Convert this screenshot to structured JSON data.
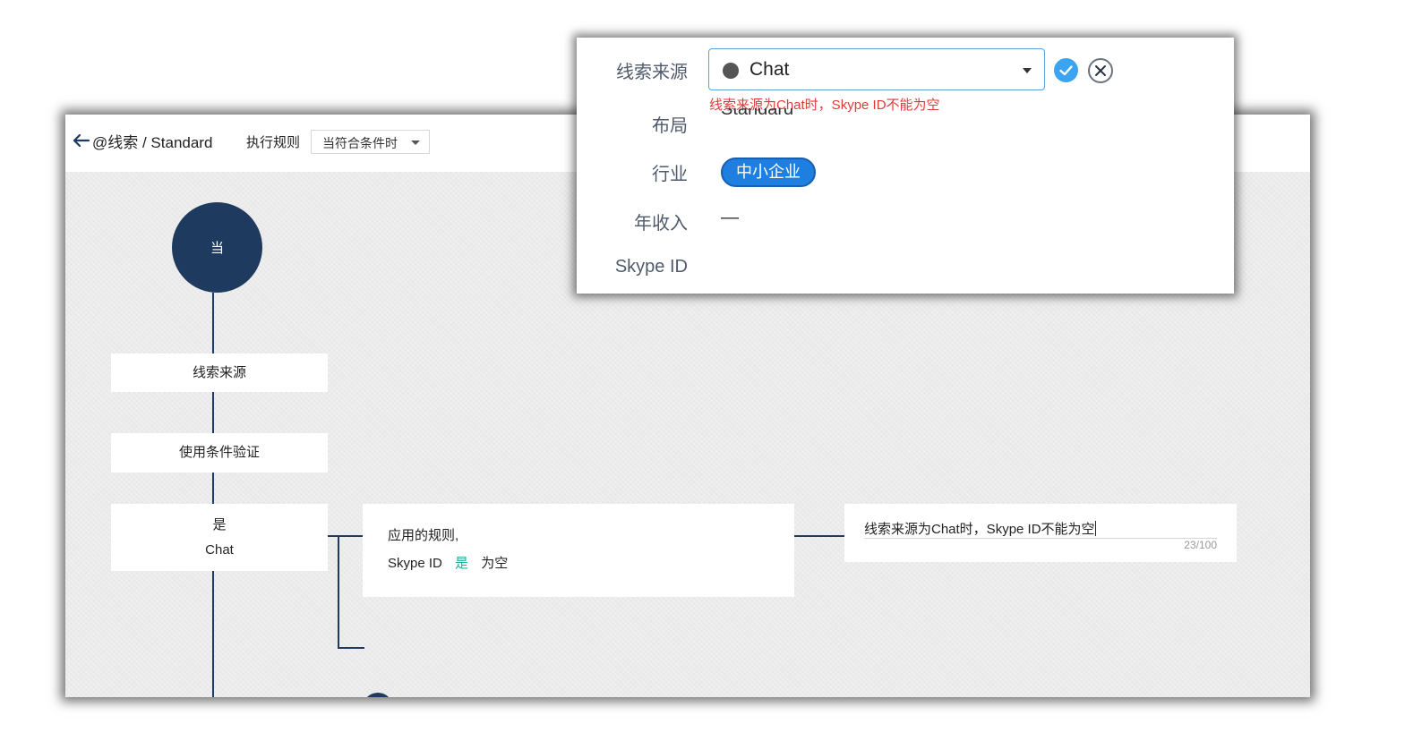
{
  "header": {
    "breadcrumb": "@线索 / Standard",
    "execution_rule_label": "执行规则",
    "trigger_select_value": "当符合条件时"
  },
  "flow": {
    "start_node_label": "当",
    "field_node_label": "线索来源",
    "validate_node_label": "使用条件验证",
    "condition_node": {
      "line1": "是",
      "line2": "Chat"
    },
    "rule_card": {
      "title": "应用的规则,",
      "field": "Skype ID",
      "operator": "是",
      "value": "为空"
    },
    "message_card": {
      "text": "线索来源为Chat时，Skype ID不能为空",
      "char_count": "23/100"
    }
  },
  "popup": {
    "fields": [
      {
        "label": "线索来源"
      },
      {
        "label": "布局"
      },
      {
        "label": "行业"
      },
      {
        "label": "年收入"
      },
      {
        "label": "Skype ID"
      }
    ],
    "source_value": "Chat",
    "error_text": "线索来源为Chat时，Skype ID不能为空",
    "layout_value": "Standard",
    "industry_tag": "中小企业",
    "revenue_value": "—"
  },
  "icons": {
    "back": "arrow-left-icon",
    "caret": "caret-down-icon",
    "confirm": "check-circle-icon",
    "cancel": "close-circle-icon",
    "add": "plus-icon"
  },
  "colors": {
    "node_dark": "#1e3a5f",
    "accent_blue": "#3ba3ef",
    "error_red": "#e03a3a",
    "teal": "#1ab394",
    "tag_blue": "#1f7fe0"
  }
}
